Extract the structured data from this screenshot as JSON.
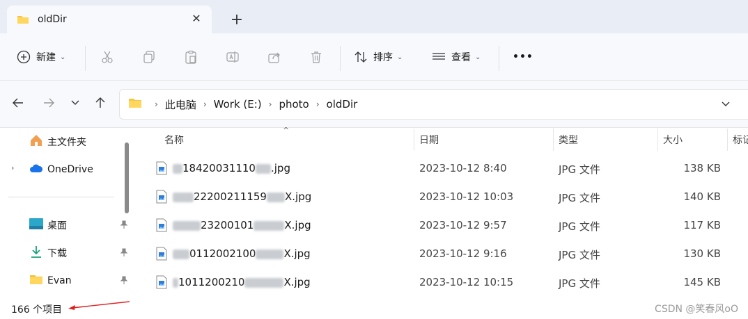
{
  "tab": {
    "title": "oldDir",
    "close_glyph": "✕",
    "new_tab_glyph": "+"
  },
  "toolbar": {
    "new_label": "新建",
    "sort_label": "排序",
    "view_label": "查看",
    "more_glyph": "•••",
    "chevron": "⌄"
  },
  "address": {
    "crumbs": [
      "此电脑",
      "Work (E:)",
      "photo",
      "oldDir"
    ],
    "sep": "›"
  },
  "sidebar": {
    "items": [
      {
        "label": "主文件夹"
      },
      {
        "label": "OneDrive"
      },
      {
        "label": "桌面"
      },
      {
        "label": "下载"
      },
      {
        "label": "Evan"
      }
    ],
    "expander": "›",
    "pin": "📌"
  },
  "columns": {
    "name": "名称",
    "date": "日期",
    "type": "类型",
    "size": "大小",
    "tags": "标记",
    "sort_indicator": "^"
  },
  "files": [
    {
      "name_prefix": "",
      "name_visible": "18420031110",
      "name_suffix": "67",
      "ext": ".jpg",
      "date": "2023-10-12 8:40",
      "type": "JPG 文件",
      "size": "138 KB"
    },
    {
      "name_prefix": "",
      "name_visible": "22200211159",
      "name_suffix": "",
      "ext": "X.jpg",
      "date": "2023-10-12 10:03",
      "type": "JPG 文件",
      "size": "140 KB"
    },
    {
      "name_prefix": "",
      "name_visible": "23200101",
      "name_suffix": "",
      "ext": "X.jpg",
      "date": "2023-10-12 9:57",
      "type": "JPG 文件",
      "size": "117 KB"
    },
    {
      "name_prefix": "",
      "name_visible": "0112002100",
      "name_suffix": "",
      "ext": "X.jpg",
      "date": "2023-10-12 9:16",
      "type": "JPG 文件",
      "size": "130 KB"
    },
    {
      "name_prefix": "",
      "name_visible": "1011200210",
      "name_suffix": "",
      "ext": "X.jpg",
      "date": "2023-10-12 10:15",
      "type": "JPG 文件",
      "size": "145 KB"
    }
  ],
  "status": {
    "count": "166 个项目"
  },
  "watermark": "CSDN @笑春风oO",
  "colors": {
    "folder": "#f4c542",
    "accent": "#1a73e8",
    "arrow": "#e02020"
  }
}
